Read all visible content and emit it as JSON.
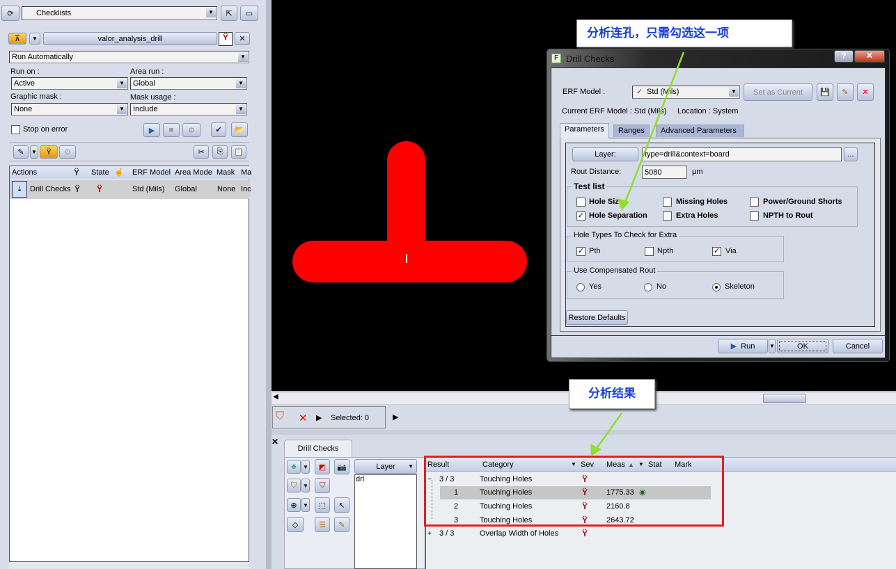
{
  "left": {
    "checklists_label": "Checklists",
    "checklist_name": "valor_analysis_drill",
    "run_mode": "Run Automatically",
    "run_on_label": "Run on :",
    "run_on": "Active",
    "area_run_label": "Area run :",
    "area_run": "Global",
    "graphic_mask_label": "Graphic mask :",
    "graphic_mask": "None",
    "mask_usage_label": "Mask usage :",
    "mask_usage": "Include",
    "stop_on_error": "Stop on error",
    "table": {
      "headers": [
        "Actions",
        "State",
        "ERF Model",
        "Area Mode",
        "Mask",
        "Ma"
      ],
      "rows": [
        {
          "action": "Drill Checks",
          "erf": "Std (Mils)",
          "area": "Global",
          "mask": "None",
          "ma": "Inc"
        }
      ]
    }
  },
  "callouts": {
    "top": "分析连孔，只需勾选这一项",
    "bottom": "分析结果"
  },
  "toolbar": {
    "selected": "Selected: 0"
  },
  "dialog": {
    "title": "Drill Checks",
    "help": "?",
    "close": "✕",
    "erf_label": "ERF Model :",
    "erf_value": "Std (Mils)",
    "set_current": "Set as Current",
    "current_erf": "Current ERF Model : Std (Mils)",
    "location": "Location :  System",
    "tabs": [
      "Parameters",
      "Ranges",
      "Advanced Parameters"
    ],
    "layer_btn": "Layer:",
    "layer_value": "type=drill&context=board",
    "browse": "...",
    "rout_label": "Rout Distance:",
    "rout_value": "5080",
    "rout_unit": "µm",
    "test_list_label": "Test list",
    "tests": [
      {
        "label": "Hole Size",
        "checked": false
      },
      {
        "label": "Missing Holes",
        "checked": false
      },
      {
        "label": "Power/Ground Shorts",
        "checked": false
      },
      {
        "label": "Hole Separation",
        "checked": true
      },
      {
        "label": "Extra Holes",
        "checked": false
      },
      {
        "label": "NPTH to Rout",
        "checked": false
      }
    ],
    "hole_types_label": "Hole Types To Check for Extra",
    "hole_types": [
      {
        "label": "Pth",
        "checked": true
      },
      {
        "label": "Npth",
        "checked": false
      },
      {
        "label": "Via",
        "checked": true
      }
    ],
    "comp_rout_label": "Use Compensated Rout",
    "comp_rout": [
      {
        "label": "Yes",
        "selected": false
      },
      {
        "label": "No",
        "selected": false
      },
      {
        "label": "Skeleton",
        "selected": true
      }
    ],
    "restore": "Restore Defaults",
    "run": "Run",
    "ok": "OK",
    "cancel": "Cancel"
  },
  "results": {
    "tab": "Drill Checks",
    "layer_header": "Layer",
    "layers": [
      "drl"
    ],
    "headers": [
      "Result",
      "Category",
      "Sev",
      "Meas",
      "Stat",
      "Mark"
    ],
    "rows": [
      {
        "result": "3 / 3",
        "category": "Touching Holes",
        "meas": "",
        "expander": "−"
      },
      {
        "result": "1",
        "category": "Touching Holes",
        "meas": "1775.33"
      },
      {
        "result": "2",
        "category": "Touching Holes",
        "meas": "2160.8"
      },
      {
        "result": "3",
        "category": "Touching Holes",
        "meas": "2643.72"
      },
      {
        "result": "3 / 3",
        "category": "Overlap Width of Holes",
        "meas": "",
        "expander": "+"
      }
    ]
  },
  "colors": {
    "canvas": "#000000",
    "feature": "#ff0000",
    "highlight_box": "#e02020",
    "callout_text": "#1a3fd0",
    "arrow": "#8ee02a"
  }
}
